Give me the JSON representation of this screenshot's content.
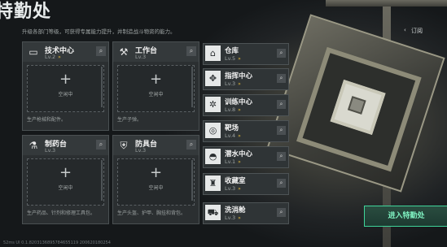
{
  "title": "特勤处",
  "description": "升级各部门等级，可获得专属能力提升，并制造战斗物资的能力。",
  "back": {
    "label": "订阅"
  },
  "enter_button": "进入特勤处",
  "footer_text": "52ms   UI 0.1.8203136895784655119 200620180254",
  "cards": [
    {
      "name": "技术中心",
      "level": "Lv.2",
      "icon": "monitor-icon",
      "slot_text": "空闲中",
      "foot": "生产枪械和配件。",
      "level_up": true
    },
    {
      "name": "工作台",
      "level": "Lv.3",
      "icon": "hammer-icon",
      "slot_text": "空闲中",
      "foot": "生产子弹。",
      "level_up": false
    },
    {
      "name": "制药台",
      "level": "Lv.3",
      "icon": "microscope-icon",
      "slot_text": "空闲中",
      "foot": "生产药品、针剂和修理工具包。",
      "level_up": false
    },
    {
      "name": "防具台",
      "level": "Lv.3",
      "icon": "armor-icon",
      "slot_text": "空闲中",
      "foot": "生产头盔、护甲、胸挂和背包。",
      "level_up": false
    }
  ],
  "facilities": [
    {
      "name": "仓库",
      "level": "Lv.5",
      "icon": "warehouse-icon"
    },
    {
      "name": "指挥中心",
      "level": "Lv.3",
      "icon": "command-icon"
    },
    {
      "name": "训练中心",
      "level": "Lv.8",
      "icon": "training-icon"
    },
    {
      "name": "靶场",
      "level": "Lv.4",
      "icon": "target-icon"
    },
    {
      "name": "潜水中心",
      "level": "Lv.1",
      "icon": "diving-icon"
    },
    {
      "name": "收藏室",
      "level": "Lv.3",
      "icon": "collection-icon"
    },
    {
      "name": "洗消舱",
      "level": "Lv.3",
      "icon": "decon-icon"
    }
  ],
  "accent_colors": {
    "upgrade_arrow": "#e0b83a",
    "enter_border": "#3fd59a"
  }
}
